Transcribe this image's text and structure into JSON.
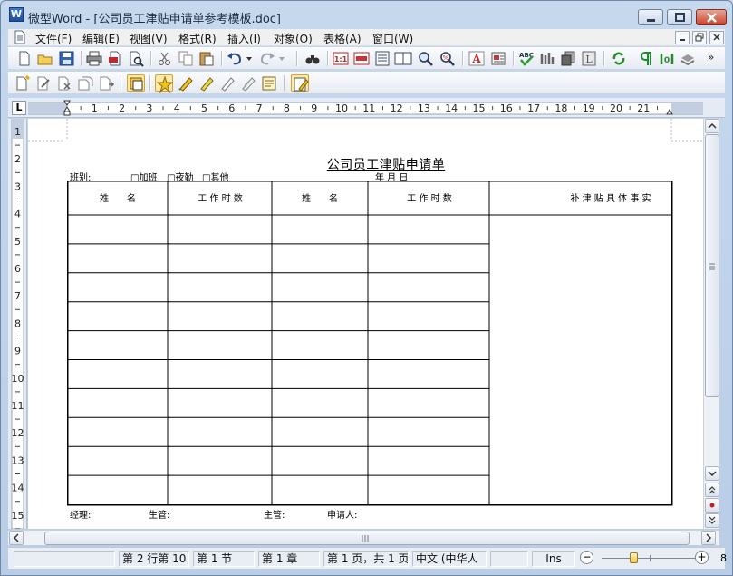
{
  "window": {
    "app_icon": "W",
    "title": "微型Word - [公司员工津贴申请单参考模板.doc]"
  },
  "menu": {
    "items": [
      "文件(F)",
      "编辑(E)",
      "视图(V)",
      "格式(R)",
      "插入(I)",
      "对象(O)",
      "表格(A)",
      "窗口(W)"
    ]
  },
  "toolbar": {
    "more": "»"
  },
  "ruler": {
    "tab_selector": "L",
    "h_numbers": [
      "1",
      "2",
      "3",
      "4",
      "5",
      "6",
      "7",
      "8",
      "9",
      "10",
      "11",
      "12",
      "13",
      "14",
      "15",
      "16",
      "17",
      "18",
      "19",
      "20",
      "21"
    ],
    "v_numbers": [
      "1",
      "2",
      "3",
      "4",
      "5",
      "6",
      "7",
      "8",
      "9",
      "10",
      "11",
      "12",
      "13",
      "14",
      "15"
    ]
  },
  "document": {
    "title": "公司员工津贴申请单",
    "shift_label": "班别:",
    "checkboxes": [
      "□加班",
      "□夜勤",
      "□其他"
    ],
    "date_label": "年    月    日",
    "headers": [
      "姓　　名",
      "工 作 时 数",
      "姓　　名",
      "工 作 时 数",
      "补 津 贴 具 体 事 实"
    ],
    "footer": {
      "manager": "经理:",
      "production": "生管:",
      "supervisor": "主管:",
      "applicant": "申请人:"
    }
  },
  "statusbar": {
    "position": "第 2 行第 10",
    "section": "第 1 节",
    "chapter": "第 1 章",
    "page": "第 1 页，共 1 页",
    "language": "中文 (中华人",
    "blank": "",
    "mode": "Ins",
    "zoom_minus": "−",
    "zoom_plus": "+",
    "zoom_clip": "8"
  }
}
